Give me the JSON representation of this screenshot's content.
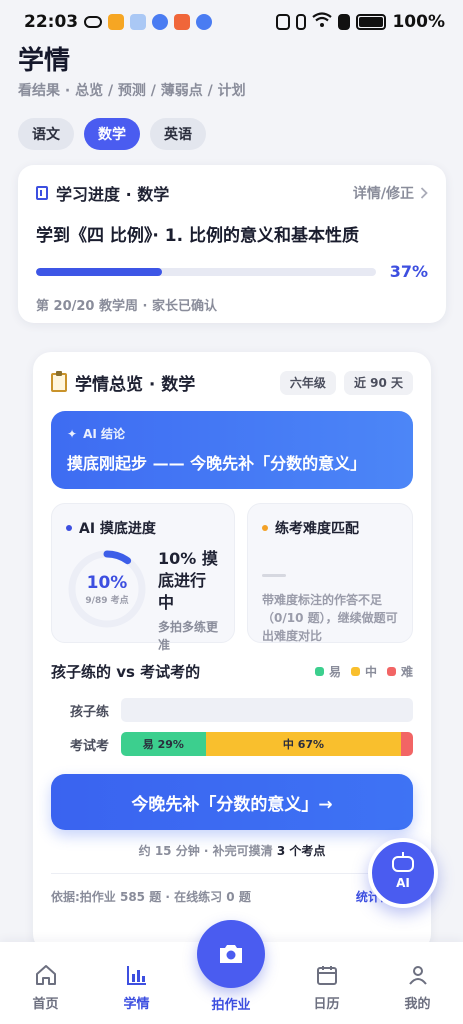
{
  "status": {
    "time": "22:03",
    "battery": "100%"
  },
  "page": {
    "title": "学情",
    "subtitle": "看结果 · 总览 / 预测 / 薄弱点 / 计划"
  },
  "subjects": [
    {
      "label": "语文",
      "active": false
    },
    {
      "label": "数学",
      "active": true
    },
    {
      "label": "英语",
      "active": false
    }
  ],
  "progress_card": {
    "title": "学习进度 · 数学",
    "link": "详情/修正",
    "topic": "学到《四 比例》· 1. 比例的意义和基本性质",
    "percent_label": "37%",
    "percent": 37,
    "footer": "第 20/20 教学周 · 家长已确认"
  },
  "overview": {
    "title": "学情总览 · 数学",
    "tags": [
      "六年级",
      "近 90 天"
    ],
    "ai_label": "AI 结论",
    "ai_message": "摸底刚起步 —— 今晚先补「分数的意义」",
    "probe": {
      "title": "AI 摸底进度",
      "percent_label": "10%",
      "percent": 10,
      "sub": "9/89 考点",
      "status": "10% 摸底进行中",
      "hint": "多拍多练更准"
    },
    "difficulty": {
      "title": "练考难度匹配",
      "desc": "带难度标注的作答不足（0/10 题），继续做题可出难度对比"
    },
    "compare": {
      "title": "孩子练的 vs 考试考的",
      "legend": [
        {
          "label": "易",
          "color": "#3ccf8e"
        },
        {
          "label": "中",
          "color": "#f9bf2d"
        },
        {
          "label": "难",
          "color": "#f26565"
        }
      ],
      "rows": [
        {
          "label": "孩子练",
          "segments": []
        },
        {
          "label": "考试考",
          "segments": [
            {
              "label": "易 29%",
              "value": 29,
              "color": "#3ccf8e"
            },
            {
              "label": "中 67%",
              "value": 67,
              "color": "#f9bf2d"
            },
            {
              "label": "",
              "value": 4,
              "color": "#f26565"
            }
          ]
        }
      ]
    },
    "cta": "今晚先补「分数的意义」→",
    "cta_note_prefix": "约 15 分钟 · 补完可摸清",
    "cta_note_bold": "3 个考点",
    "basis": "依据:拍作业 585 题 · 在线练习 0 题",
    "basis_link": "统计口径 ›"
  },
  "fab": {
    "label": "AI"
  },
  "tabs": [
    {
      "label": "首页",
      "icon": "home-icon",
      "active": false
    },
    {
      "label": "学情",
      "icon": "chart-icon",
      "active": true
    },
    {
      "label": "拍作业",
      "icon": "camera-icon",
      "active": false
    },
    {
      "label": "日历",
      "icon": "calendar-icon",
      "active": false
    },
    {
      "label": "我的",
      "icon": "person-icon",
      "active": false
    }
  ],
  "colors": {
    "accent": "#4a5cf0",
    "primary_text": "#1f2233",
    "muted": "#8a8d9b"
  }
}
